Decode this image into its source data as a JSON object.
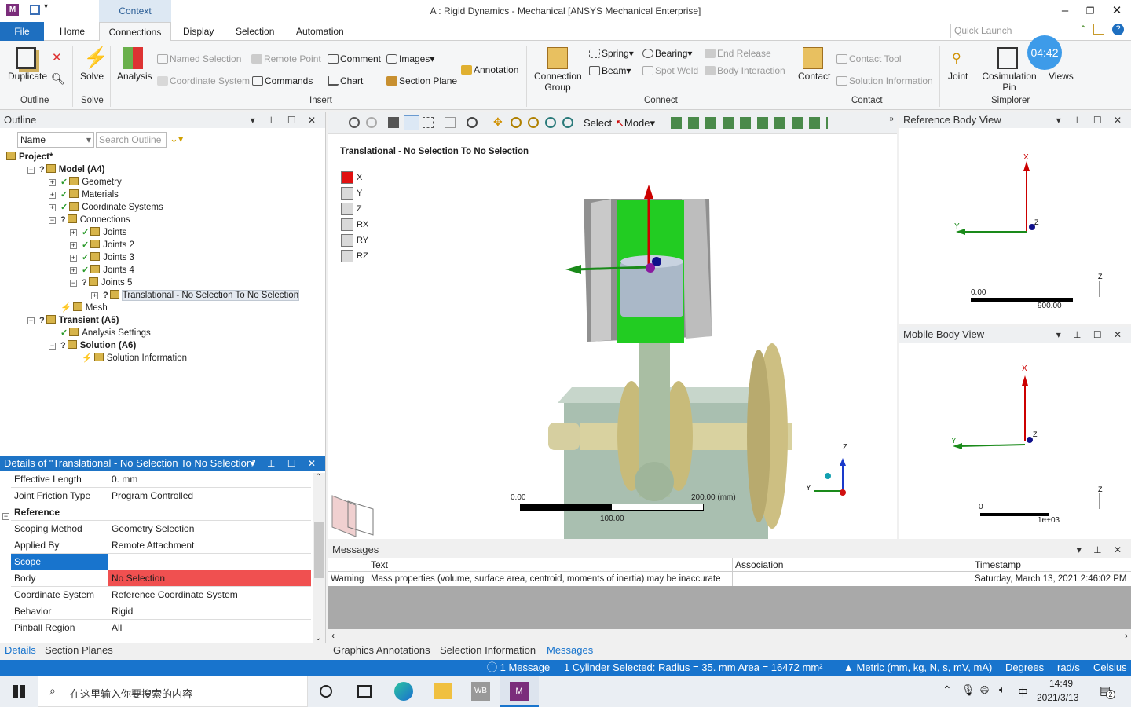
{
  "window": {
    "title": "A : Rigid Dynamics - Mechanical [ANSYS Mechanical Enterprise]",
    "context_tab": "Context",
    "app_icon": "M"
  },
  "tabs": [
    "File",
    "Home",
    "Connections",
    "Display",
    "Selection",
    "Automation"
  ],
  "active_tab": "Connections",
  "quick_launch": {
    "placeholder": "Quick Launch"
  },
  "timer": "04:42",
  "ribbon": {
    "outline": {
      "duplicate": "Duplicate",
      "group": "Outline"
    },
    "solve": {
      "solve": "Solve",
      "group": "Solve"
    },
    "insert": {
      "analysis": "Analysis",
      "named_selection": "Named Selection",
      "remote_point": "Remote Point",
      "comment": "Comment",
      "images": "Images",
      "annotation": "Annotation",
      "coordinate_system": "Coordinate System",
      "commands": "Commands",
      "chart": "Chart",
      "section_plane": "Section Plane",
      "group": "Insert"
    },
    "connect": {
      "connection_group": "Connection Group",
      "spring": "Spring",
      "bearing": "Bearing",
      "end_release": "End Release",
      "beam": "Beam",
      "spot_weld": "Spot Weld",
      "body_interaction": "Body Interaction",
      "group": "Connect"
    },
    "contact": {
      "contact": "Contact",
      "contact_tool": "Contact Tool",
      "solution_information": "Solution Information",
      "group": "Contact"
    },
    "simplorer": {
      "joint": "Joint",
      "cosimulation_pin": "Cosimulation Pin",
      "views": "Views",
      "group": "Simplorer"
    }
  },
  "outline": {
    "title": "Outline",
    "name_filter": "Name",
    "search_placeholder": "Search Outline",
    "tree": [
      {
        "label": "Project*",
        "level": 0,
        "bold": true
      },
      {
        "label": "Model (A4)",
        "level": 1,
        "bold": true,
        "status": "?"
      },
      {
        "label": "Geometry",
        "level": 2,
        "status": "✓"
      },
      {
        "label": "Materials",
        "level": 2,
        "status": "✓"
      },
      {
        "label": "Coordinate Systems",
        "level": 2,
        "status": "✓"
      },
      {
        "label": "Connections",
        "level": 2,
        "status": "?"
      },
      {
        "label": "Joints",
        "level": 3,
        "status": "✓"
      },
      {
        "label": "Joints 2",
        "level": 3,
        "status": "✓"
      },
      {
        "label": "Joints 3",
        "level": 3,
        "status": "✓"
      },
      {
        "label": "Joints 4",
        "level": 3,
        "status": "✓"
      },
      {
        "label": "Joints 5",
        "level": 3,
        "status": "?"
      },
      {
        "label": "Translational - No Selection To No Selection",
        "level": 4,
        "status": "?",
        "selected": true
      },
      {
        "label": "Mesh",
        "level": 2,
        "status": "⚡"
      },
      {
        "label": "Transient (A5)",
        "level": 1,
        "bold": true,
        "status": "?"
      },
      {
        "label": "Analysis Settings",
        "level": 2,
        "status": "✓"
      },
      {
        "label": "Solution (A6)",
        "level": 2,
        "bold": true,
        "status": "?"
      },
      {
        "label": "Solution Information",
        "level": 3,
        "status": "⚡"
      }
    ]
  },
  "details": {
    "title": "Details of \"Translational - No Selection To No Selection\"",
    "rows": [
      {
        "key": "Effective Length",
        "value": "0. mm"
      },
      {
        "key": "Joint Friction Type",
        "value": "Program Controlled"
      },
      {
        "key": "Reference",
        "group": true
      },
      {
        "key": "Scoping Method",
        "value": "Geometry Selection"
      },
      {
        "key": "Applied By",
        "value": "Remote Attachment"
      },
      {
        "key": "Scope",
        "value": "",
        "selected": true
      },
      {
        "key": "Body",
        "value": "No Selection",
        "error": true
      },
      {
        "key": "Coordinate System",
        "value": "Reference Coordinate System"
      },
      {
        "key": "Behavior",
        "value": "Rigid"
      },
      {
        "key": "Pinball Region",
        "value": "All"
      }
    ],
    "tabs": [
      "Details",
      "Section Planes"
    ]
  },
  "viewport": {
    "toolbar": {
      "select": "Select",
      "mode": "Mode"
    },
    "title": "Translational - No Selection To No Selection",
    "dofs": [
      {
        "label": "X",
        "active": true
      },
      {
        "label": "Y"
      },
      {
        "label": "Z"
      },
      {
        "label": "RX"
      },
      {
        "label": "RY"
      },
      {
        "label": "RZ"
      }
    ],
    "scale": {
      "min": "0.00",
      "max": "200.00 (mm)",
      "mid": "100.00"
    },
    "axes": {
      "x": "X",
      "y": "Y",
      "z": "Z"
    }
  },
  "reference_view": {
    "title": "Reference Body View",
    "scale_min": "0.00",
    "scale_max": "900.00"
  },
  "mobile_view": {
    "title": "Mobile Body View",
    "scale_min": "0",
    "scale_max": "1e+03"
  },
  "messages": {
    "title": "Messages",
    "columns": [
      "",
      "Text",
      "Association",
      "Timestamp"
    ],
    "rows": [
      {
        "type": "Warning",
        "text": "Mass properties (volume, surface area, centroid, moments of inertia) may be inaccurate",
        "association": "",
        "timestamp": "Saturday, March 13, 2021 2:46:02 PM"
      }
    ],
    "tabs": [
      "Graphics Annotations",
      "Selection Information",
      "Messages"
    ]
  },
  "status": {
    "messages": "1 Message",
    "selection": "1 Cylinder Selected: Radius = 35. mm  Area = 16472 mm²",
    "units": "Metric (mm, kg, N, s, mV, mA)",
    "angle": "Degrees",
    "rot_velocity": "rad/s",
    "temperature": "Celsius"
  },
  "taskbar": {
    "search_placeholder": "在这里输入你要搜索的内容",
    "time": "14:49",
    "date": "2021/3/13",
    "ime": "中",
    "notifications": "2",
    "wb": "WB",
    "m": "M"
  },
  "colors": {
    "accent": "#1874cd",
    "error": "#f05050",
    "selection_green": "#22cc22"
  }
}
